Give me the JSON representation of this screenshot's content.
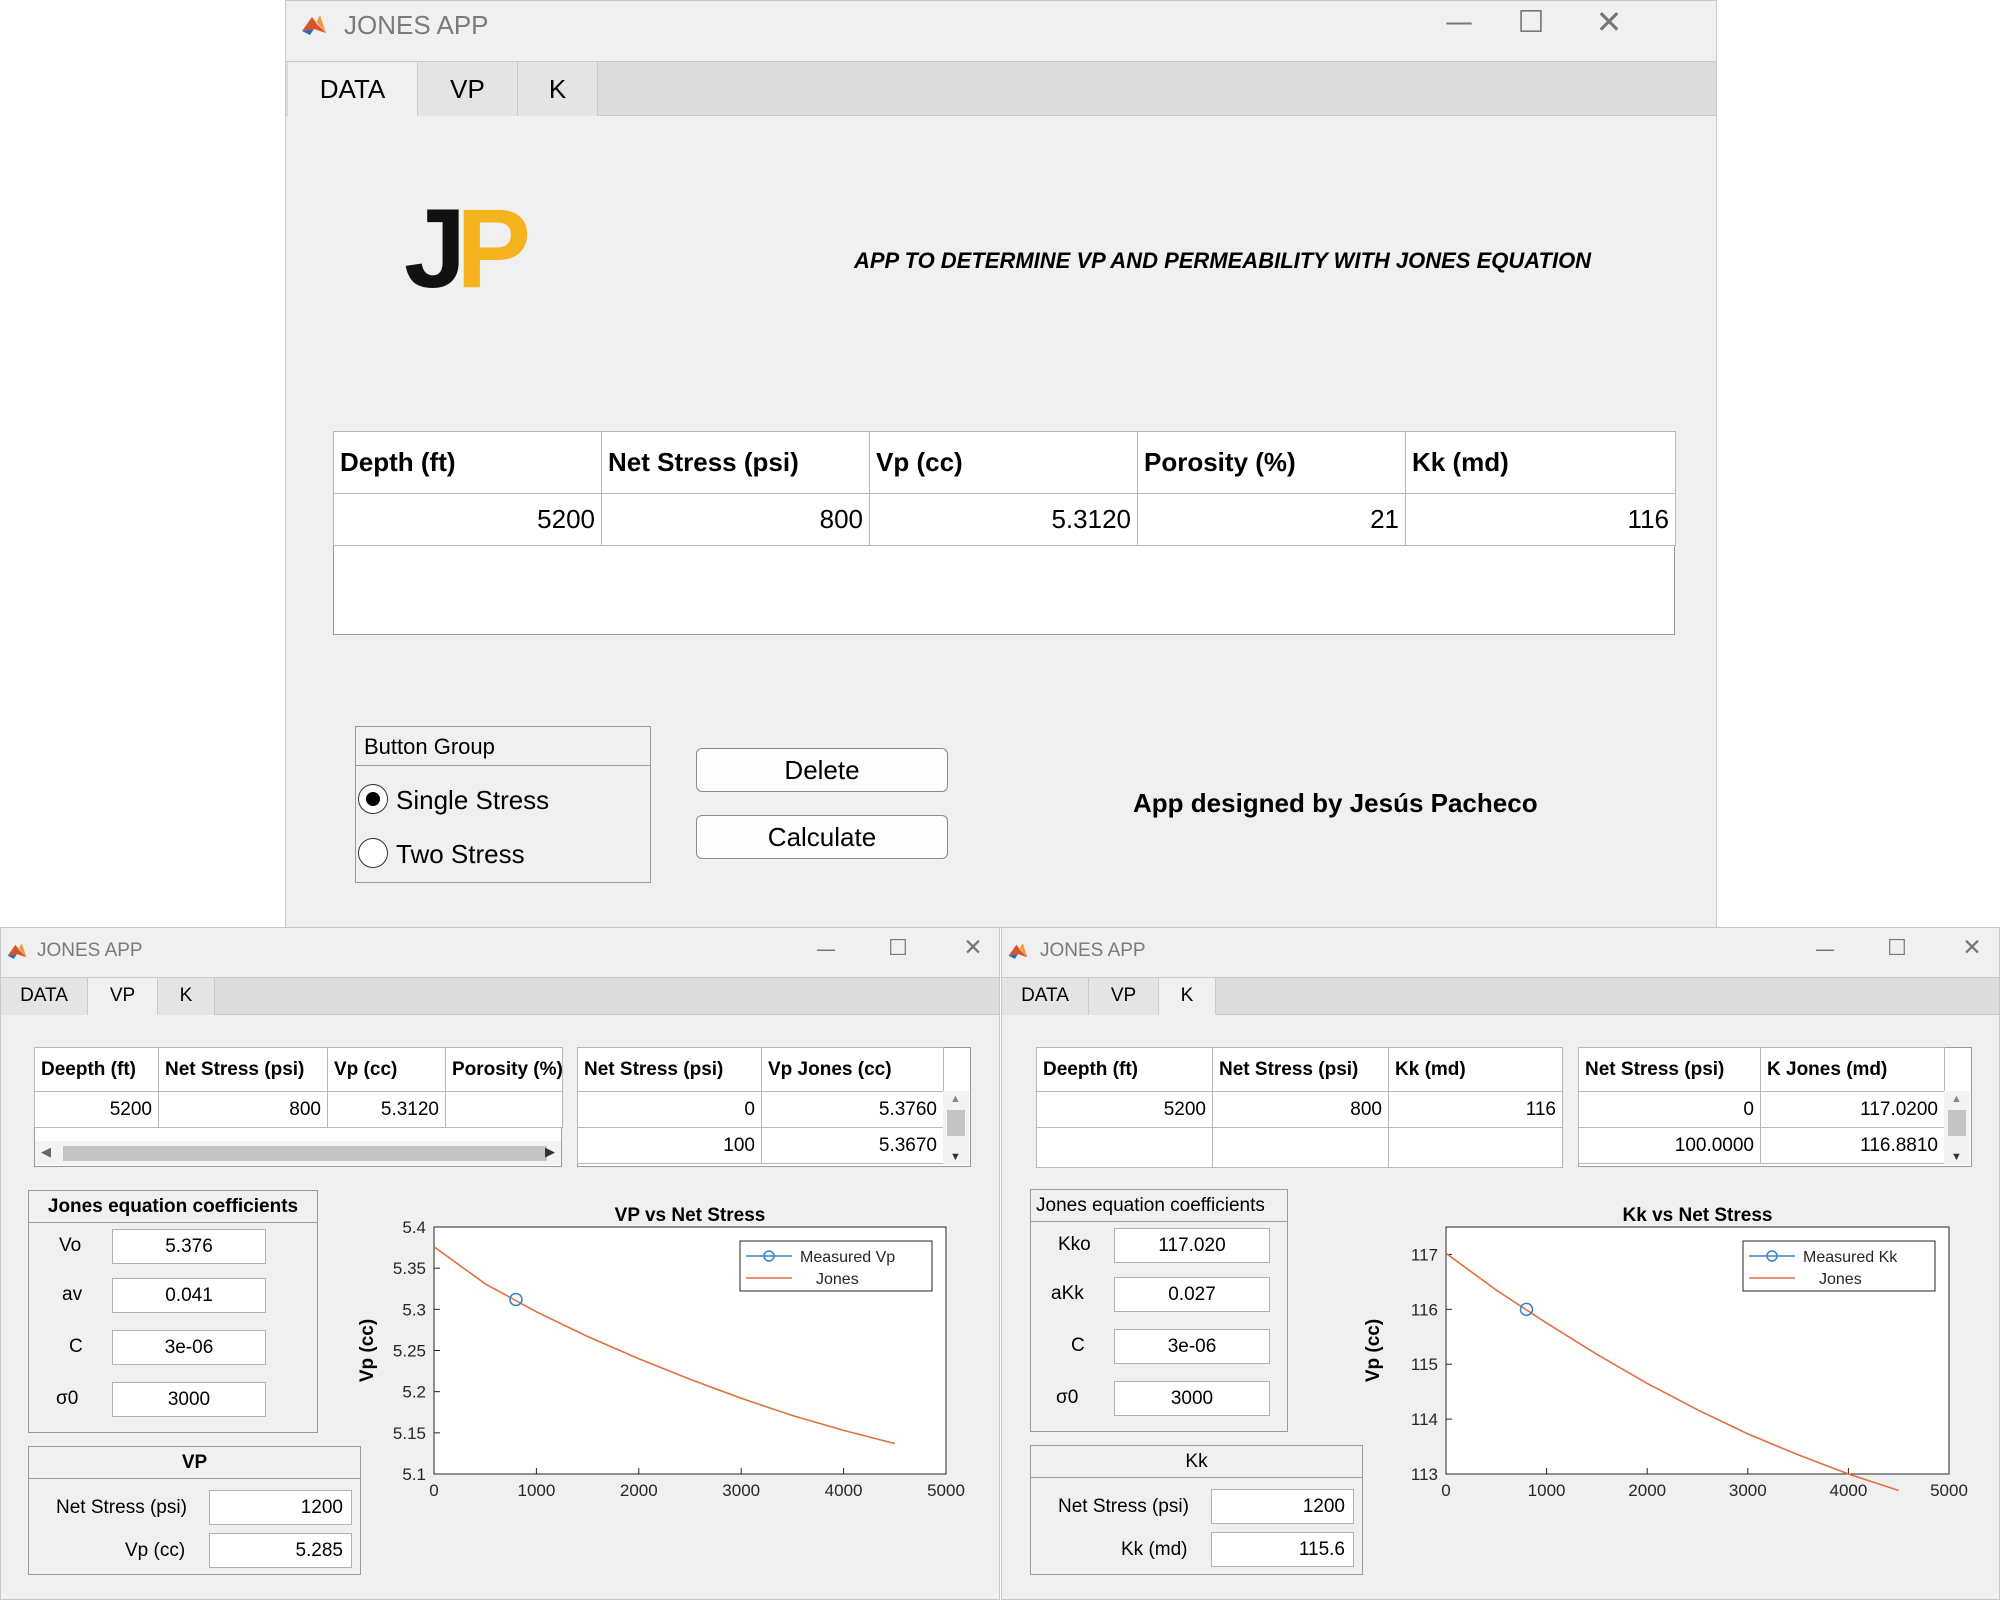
{
  "colors": {
    "window_bg": "#f0f0f0",
    "measured_marker": "#3b82c4",
    "jones_line": "#e2703f",
    "logo_j": "#111111",
    "logo_p": "#f5b41e"
  },
  "main_window": {
    "title": "JONES APP",
    "icons": [
      "matlab-icon",
      "minimize-icon",
      "maximize-icon",
      "close-icon"
    ],
    "tabs": [
      "DATA",
      "VP",
      "K"
    ],
    "active_tab": "DATA",
    "logo": {
      "letter1": "J",
      "letter2": "P"
    },
    "heading": "APP TO DETERMINE VP AND PERMEABILITY WITH JONES EQUATION",
    "table": {
      "headers": [
        "Depth (ft)",
        "Net Stress (psi)",
        "Vp (cc)",
        "Porosity (%)",
        "Kk (md)"
      ],
      "rows": [
        [
          "5200",
          "800",
          "5.3120",
          "21",
          "116"
        ]
      ]
    },
    "button_group": {
      "title": "Button Group",
      "options": [
        "Single Stress",
        "Two Stress"
      ],
      "selected": "Single Stress"
    },
    "delete_label": "Delete",
    "calculate_label": "Calculate",
    "credit": "App designed by Jesús Pacheco"
  },
  "vp_window": {
    "title": "JONES APP",
    "tabs": [
      "DATA",
      "VP",
      "K"
    ],
    "active_tab": "VP",
    "data_table": {
      "headers": [
        "Deepth (ft)",
        "Net Stress (psi)",
        "Vp (cc)",
        "Porosity (%)"
      ],
      "rows": [
        [
          "5200",
          "800",
          "5.3120",
          ""
        ]
      ]
    },
    "result_table": {
      "headers": [
        "Net Stress (psi)",
        "Vp Jones (cc)"
      ],
      "rows": [
        [
          "0",
          "5.3760"
        ],
        [
          "100",
          "5.3670"
        ]
      ]
    },
    "coefficients": {
      "title": "Jones equation coefficients",
      "items": [
        {
          "label": "Vo",
          "value": "5.376"
        },
        {
          "label": "av",
          "value": "0.041"
        },
        {
          "label": "C",
          "value": "3e-06"
        },
        {
          "label": "σ0",
          "value": "3000"
        }
      ]
    },
    "calc_panel": {
      "title": "VP",
      "items": [
        {
          "label": "Net Stress (psi)",
          "value": "1200"
        },
        {
          "label": "Vp (cc)",
          "value": "5.285"
        }
      ]
    }
  },
  "k_window": {
    "title": "JONES APP",
    "tabs": [
      "DATA",
      "VP",
      "K"
    ],
    "active_tab": "K",
    "data_table": {
      "headers": [
        "Deepth (ft)",
        "Net Stress (psi)",
        "Kk (md)"
      ],
      "rows": [
        [
          "5200",
          "800",
          "116"
        ],
        [
          "",
          "",
          ""
        ]
      ]
    },
    "result_table": {
      "headers": [
        "Net Stress (psi)",
        "K Jones (md)"
      ],
      "rows": [
        [
          "0",
          "117.0200"
        ],
        [
          "100.0000",
          "116.8810"
        ]
      ]
    },
    "coefficients": {
      "title": "Jones equation coefficients",
      "items": [
        {
          "label": "Kko",
          "value": "117.020"
        },
        {
          "label": "aKk",
          "value": "0.027"
        },
        {
          "label": "C",
          "value": "3e-06"
        },
        {
          "label": "σ0",
          "value": "3000"
        }
      ]
    },
    "calc_panel": {
      "title": "Kk",
      "items": [
        {
          "label": "Net Stress (psi)",
          "value": "1200"
        },
        {
          "label": "Kk (md)",
          "value": "115.6"
        }
      ]
    }
  },
  "chart_data": [
    {
      "type": "line",
      "title": "VP vs Net Stress",
      "xlabel": "Net Stress (psi)",
      "ylabel": "Vp (cc)",
      "xlim": [
        0,
        5000
      ],
      "ylim": [
        5.1,
        5.4
      ],
      "xticks": [
        "0",
        "1000",
        "2000",
        "3000",
        "4000",
        "5000"
      ],
      "yticks": [
        "5.1",
        "5.15",
        "5.2",
        "5.25",
        "5.3",
        "5.35",
        "5.4"
      ],
      "legend_position": "top-right",
      "series": [
        {
          "name": "Measured Vp",
          "marker": "circle",
          "x": [
            800
          ],
          "y": [
            5.312
          ]
        },
        {
          "name": "Jones",
          "x": [
            0,
            500,
            1000,
            1500,
            2000,
            2500,
            3000,
            3500,
            4000,
            4500
          ],
          "y": [
            5.376,
            5.331,
            5.297,
            5.267,
            5.24,
            5.215,
            5.192,
            5.171,
            5.153,
            5.137
          ]
        }
      ]
    },
    {
      "type": "line",
      "title": "Kk vs Net Stress",
      "xlabel": "Net Stress (psi)",
      "ylabel": "Vp (cc)",
      "xlim": [
        0,
        5000
      ],
      "ylim": [
        113,
        117.5
      ],
      "xticks": [
        "0",
        "1000",
        "2000",
        "3000",
        "4000",
        "5000"
      ],
      "yticks": [
        "113",
        "114",
        "115",
        "116",
        "117"
      ],
      "legend_position": "top-right",
      "series": [
        {
          "name": "Measured Kk",
          "marker": "circle",
          "x": [
            800
          ],
          "y": [
            116
          ]
        },
        {
          "name": "Jones",
          "x": [
            0,
            500,
            1000,
            1500,
            2000,
            2500,
            3000,
            3500,
            4000,
            4500
          ],
          "y": [
            117.02,
            116.35,
            115.75,
            115.18,
            114.65,
            114.17,
            113.73,
            113.35,
            113.0,
            112.7
          ]
        }
      ]
    }
  ]
}
